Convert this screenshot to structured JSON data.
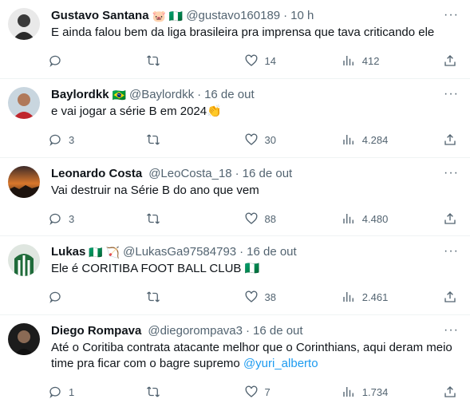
{
  "tweets": [
    {
      "name": "Gustavo Santana",
      "emoji": "🐷 🇳🇬",
      "handle": "@gustavo160189",
      "time": "10 h",
      "text": "E ainda falou bem da liga brasileira pra imprensa que tava criticando ele",
      "replies": "",
      "retweets": "",
      "likes": "14",
      "views": "412"
    },
    {
      "name": "Baylordkk",
      "emoji": "🇧🇷",
      "handle": "@Baylordkk",
      "time": "16 de out",
      "text": "e vai jogar a série B em 2024👏",
      "replies": "3",
      "retweets": "",
      "likes": "30",
      "views": "4.284"
    },
    {
      "name": "Leonardo Costa",
      "emoji": "",
      "handle": "@LeoCosta_18",
      "time": "16 de out",
      "text": "Vai destruir na Série B do ano que vem",
      "replies": "3",
      "retweets": "",
      "likes": "88",
      "views": "4.480"
    },
    {
      "name": "Lukas",
      "emoji": "🇳🇬 🏹",
      "handle": "@LukasGa97584793",
      "time": "16 de out",
      "text": "Ele é CORITIBA FOOT BALL CLUB 🇳🇬",
      "replies": "",
      "retweets": "",
      "likes": "38",
      "views": "2.461"
    },
    {
      "name": "Diego Rompava",
      "emoji": "",
      "handle": "@diegorompava3",
      "time": "16 de out",
      "text": "Até o Coritiba contrata atacante melhor que o Corinthians, aqui deram meio time pra ficar com o bagre supremo ",
      "mention": "@yuri_alberto",
      "replies": "1",
      "retweets": "",
      "likes": "7",
      "views": "1.734"
    }
  ],
  "ui": {
    "separator": "·",
    "more": "···"
  },
  "colors": {
    "text": "#0f1419",
    "secondary": "#536471",
    "link": "#1d9bf0",
    "divider": "#eff3f4"
  }
}
